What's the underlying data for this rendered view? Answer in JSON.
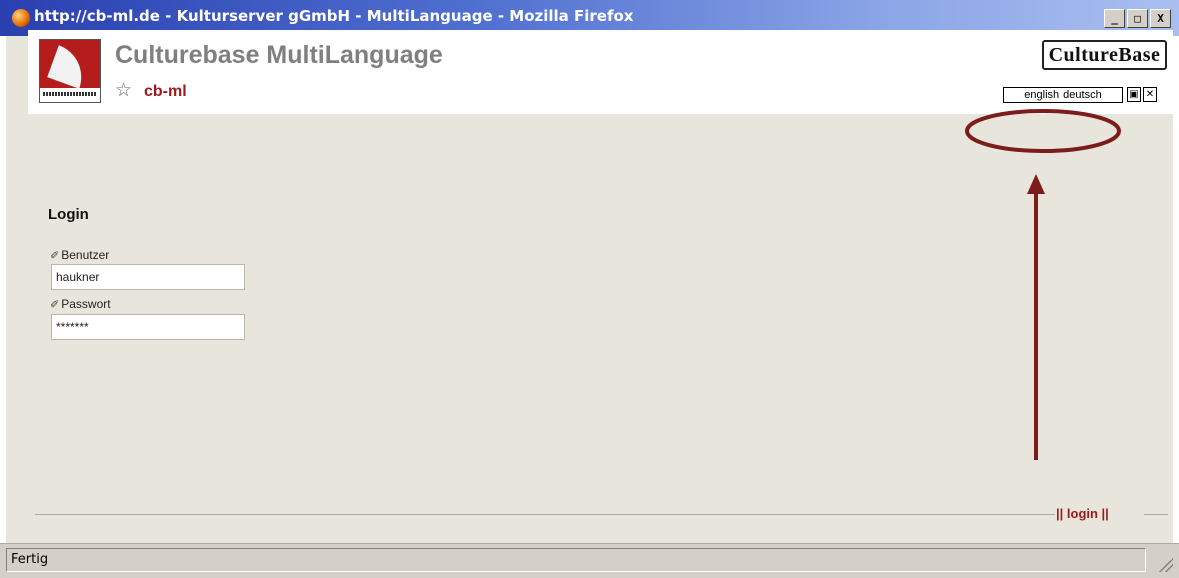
{
  "window": {
    "title": "http://cb-ml.de - Kulturserver gGmbH - MultiLanguage - Mozilla Firefox",
    "controls": {
      "minimize": "_",
      "maximize": "□",
      "close": "X"
    }
  },
  "header": {
    "app_title": "Culturebase MultiLanguage",
    "subtitle": "cb-ml",
    "brand_logo": "CultureBase",
    "languages": [
      "english",
      "deutsch"
    ]
  },
  "login": {
    "heading": "Login",
    "user_label": "Benutzer",
    "user_value": "haukner",
    "password_label": "Passwort",
    "password_value": "*******"
  },
  "footer": {
    "nav_text": "|| login ||"
  },
  "status": {
    "text": "Fertig"
  },
  "icons": {
    "title_icon": "firefox-icon",
    "star": "star-icon",
    "edit": "pencil-icon"
  },
  "colors": {
    "accent": "#9e1a1a",
    "titlebar": "#2a3fb0",
    "page_bg": "#e8e6dc",
    "annotation": "#7d1c1c"
  }
}
